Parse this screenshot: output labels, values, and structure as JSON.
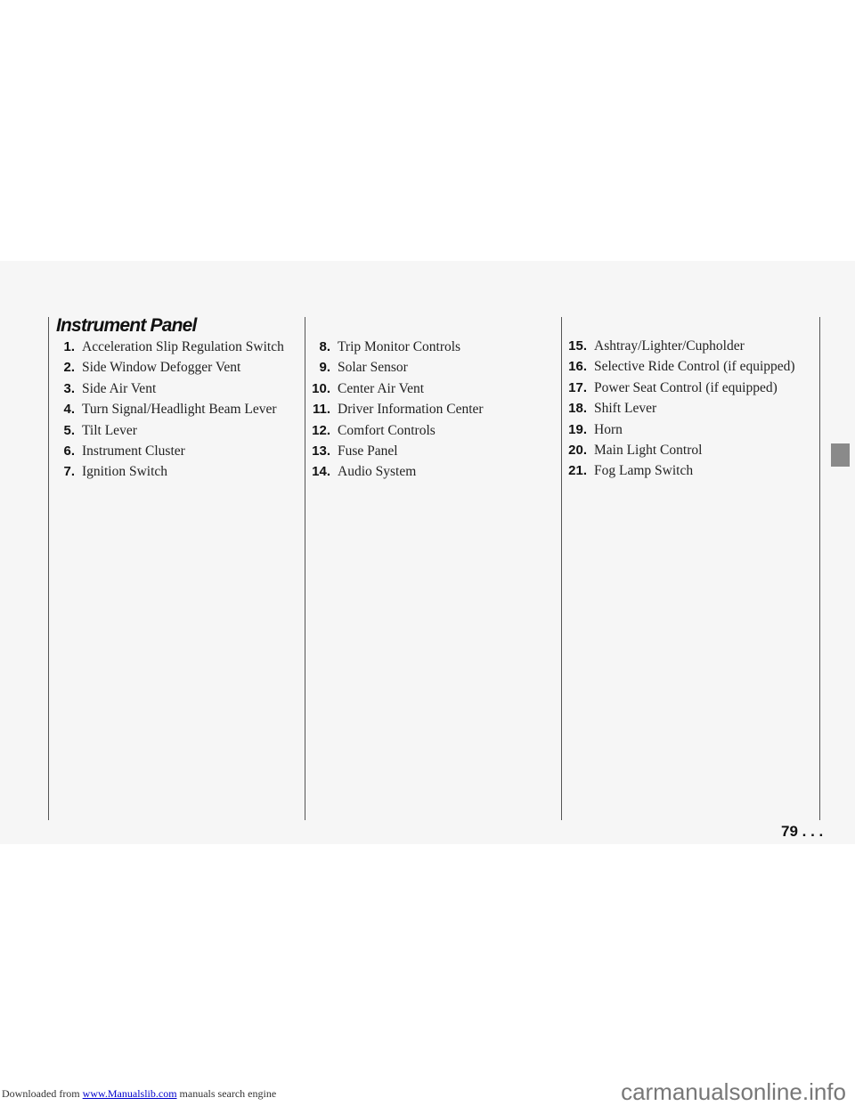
{
  "section_title": "Instrument Panel",
  "columns": [
    [
      {
        "num": "1.",
        "text": "Acceleration Slip Regulation Switch"
      },
      {
        "num": "2.",
        "text": "Side Window Defogger Vent"
      },
      {
        "num": "3.",
        "text": "Side Air Vent"
      },
      {
        "num": "4.",
        "text": "Turn Signal/Headlight Beam Lever"
      },
      {
        "num": "5.",
        "text": "Tilt Lever"
      },
      {
        "num": "6.",
        "text": "Instrument Cluster"
      },
      {
        "num": "7.",
        "text": "Ignition Switch"
      }
    ],
    [
      {
        "num": "8.",
        "text": "Trip Monitor Controls"
      },
      {
        "num": "9.",
        "text": "Solar Sensor"
      },
      {
        "num": "10.",
        "text": "Center Air Vent"
      },
      {
        "num": "11.",
        "text": "Driver Information Center"
      },
      {
        "num": "12.",
        "text": "Comfort Controls"
      },
      {
        "num": "13.",
        "text": "Fuse Panel"
      },
      {
        "num": "14.",
        "text": "Audio System"
      }
    ],
    [
      {
        "num": "15.",
        "text": "Ashtray/Lighter/Cupholder"
      },
      {
        "num": "16.",
        "text": "Selective Ride Control (if equipped)"
      },
      {
        "num": "17.",
        "text": "Power Seat Control (if equipped)"
      },
      {
        "num": "18.",
        "text": "Shift Lever"
      },
      {
        "num": "19.",
        "text": "Horn"
      },
      {
        "num": "20.",
        "text": "Main Light Control"
      },
      {
        "num": "21.",
        "text": "Fog Lamp Switch"
      }
    ]
  ],
  "page_number": "79 . . .",
  "footer": {
    "prefix": "Downloaded from ",
    "link": "www.Manualslib.com",
    "suffix": " manuals search engine"
  },
  "watermark": "carmanualsonline.info"
}
